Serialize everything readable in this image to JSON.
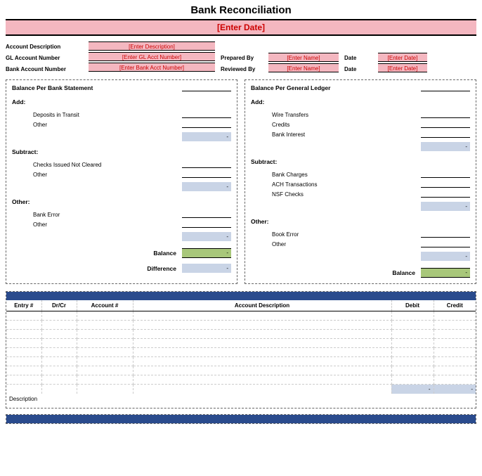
{
  "title": "Bank Reconciliation",
  "date_placeholder": "[Enter Date]",
  "meta": {
    "account_desc_label": "Account Description",
    "account_desc_value": "[Enter Description]",
    "gl_label": "GL Account Number",
    "gl_value": "[Enter GL Acct Number]",
    "bank_acct_label": "Bank Account Number",
    "bank_acct_value": "[Enter Bank Acct Number]",
    "prepared_label": "Prepared By",
    "prepared_value": "[Enter Name]",
    "reviewed_label": "Reviewed By",
    "reviewed_value": "[Enter Name]",
    "date_label": "Date",
    "date1_value": "[Enter Date]",
    "date2_value": "[Enter Date]"
  },
  "left": {
    "title": "Balance Per Bank Statement",
    "add_label": "Add:",
    "add_items": [
      "Deposits in Transit",
      "Other"
    ],
    "subtract_label": "Subtract:",
    "subtract_items": [
      "Checks Issued Not Cleared",
      "Other"
    ],
    "other_label": "Other:",
    "other_items": [
      "Bank Error",
      "Other"
    ],
    "balance_label": "Balance",
    "balance_value": "-",
    "difference_label": "Difference",
    "difference_value": "-",
    "sub_value": "-"
  },
  "right": {
    "title": "Balance Per General Ledger",
    "add_label": "Add:",
    "add_items": [
      "Wire Transfers",
      "Credits",
      "Bank Interest"
    ],
    "subtract_label": "Subtract:",
    "subtract_items": [
      "Bank Charges",
      "ACH Transactions",
      "NSF Checks"
    ],
    "other_label": "Other:",
    "other_items": [
      "Book Error",
      "Other"
    ],
    "balance_label": "Balance",
    "balance_value": "-",
    "sub_value": "-"
  },
  "table": {
    "headers": [
      "Entry #",
      "Dr/Cr",
      "Account #",
      "Account Description",
      "Debit",
      "Credit"
    ],
    "rows": 8,
    "total_value": "-",
    "description_label": "Description"
  }
}
